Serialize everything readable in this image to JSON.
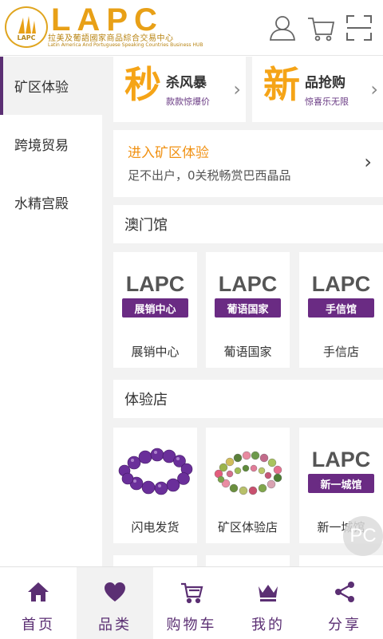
{
  "header": {
    "brand": "LAPC",
    "subtitle_cn": "拉美及葡語國家商品綜合交易中心",
    "subtitle_en": "Latin America And Portuguese Speaking Countries Business HUB",
    "logo_label": "LAPC",
    "icons": [
      "user-icon",
      "cart-icon",
      "scan-icon"
    ]
  },
  "sidebar": {
    "items": [
      {
        "label": "矿区体验"
      },
      {
        "label": "跨境贸易"
      },
      {
        "label": "水精宫殿"
      }
    ]
  },
  "promos": [
    {
      "big": "秒",
      "title": "杀风暴",
      "sub": "款款惊爆价",
      "chevron": "›"
    },
    {
      "big": "新",
      "title": "品抢购",
      "sub": "惊喜乐无限",
      "chevron": "›"
    }
  ],
  "enter": {
    "title": "进入矿区体验",
    "desc": "足不出户，0关税畅赏巴西晶品",
    "chevron": "›"
  },
  "macau": {
    "title": "澳门馆",
    "tiles": [
      {
        "logo": "LAPC",
        "tag": "展销中心",
        "caption": "展销中心"
      },
      {
        "logo": "LAPC",
        "tag": "葡语国家",
        "caption": "葡语国家"
      },
      {
        "logo": "LAPC",
        "tag": "手信馆",
        "caption": "手信店"
      }
    ]
  },
  "store": {
    "title": "体验店",
    "tiles": [
      {
        "caption": "闪电发货"
      },
      {
        "caption": "矿区体验店"
      },
      {
        "logo": "LAPC",
        "tag": "新一城馆",
        "caption": "新一城馆"
      }
    ]
  },
  "pc_badge": "PC",
  "tabbar": {
    "items": [
      {
        "label": "首页",
        "icon": "home-icon"
      },
      {
        "label": "品类",
        "icon": "heart-icon"
      },
      {
        "label": "购物车",
        "icon": "cart-icon"
      },
      {
        "label": "我的",
        "icon": "crown-icon"
      },
      {
        "label": "分享",
        "icon": "share-icon"
      }
    ],
    "active_index": 1
  },
  "colors": {
    "accent_purple": "#5b2f73",
    "accent_orange": "#f5a417",
    "background": "#f2f2f2"
  }
}
